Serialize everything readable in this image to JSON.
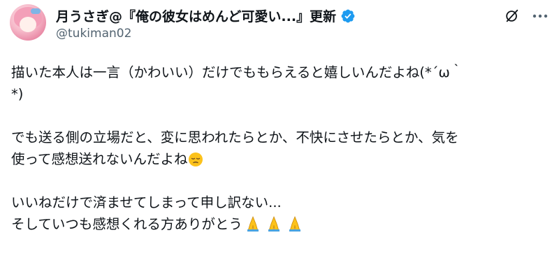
{
  "post": {
    "author": {
      "display_name": "月うさぎ@『俺の彼女はめんど可愛い...』更新",
      "handle": "@tukiman02",
      "verified": true
    },
    "text_lines": [
      "描いた本人は一言（かわいい）だけでももらえると嬉しいんだよね(*´ω｀",
      "*)",
      "でも送る側の立場だと、変に思われたらとか、不快にさせたらとか、気を",
      "使って感想送れないんだよね",
      "いいねだけで済ませてしまって申し訳ない...",
      "そしていつも感想くれる方ありがとう"
    ],
    "emojis": {
      "pensive": "pensive-face-emoji",
      "pray": "folded-hands-emoji"
    }
  },
  "header_icons": [
    "grok-icon",
    "more-icon"
  ],
  "colors": {
    "text": "#0f1419",
    "secondary": "#536471",
    "verified": "#1d9bf0",
    "avatar": "#f39fb8"
  }
}
